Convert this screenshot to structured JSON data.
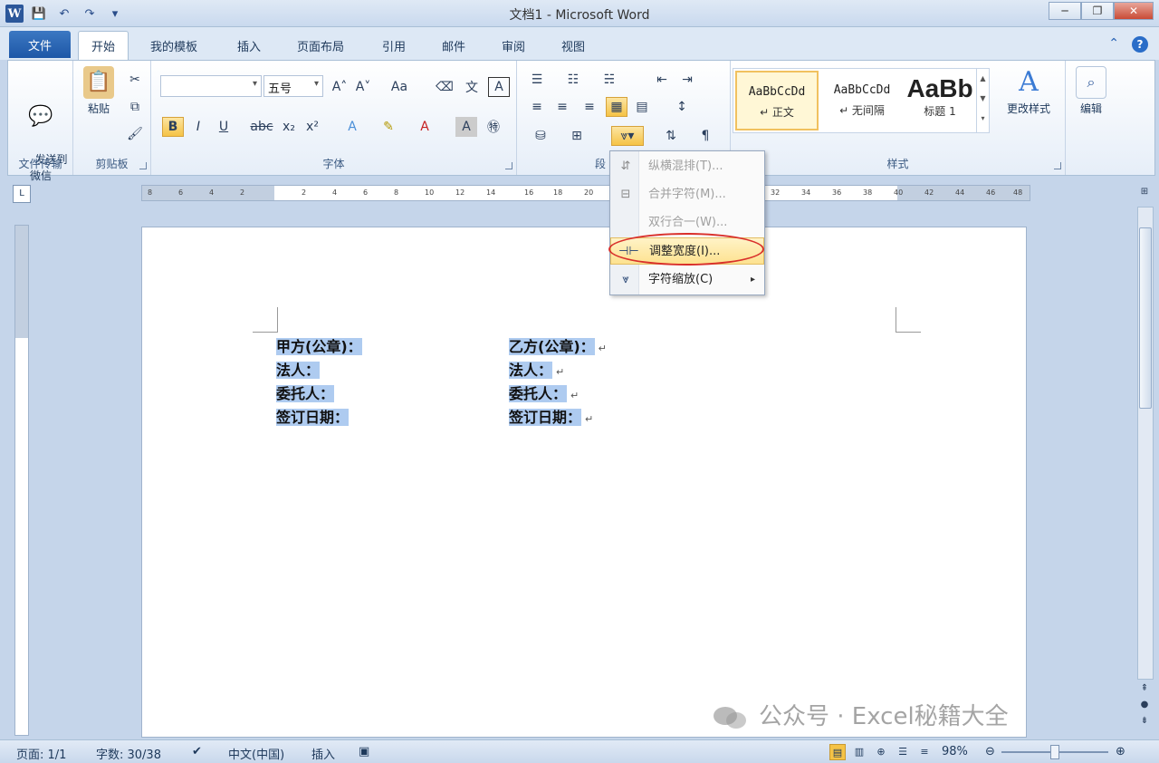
{
  "window": {
    "title": "文档1 - Microsoft Word",
    "app_icon": "W",
    "colors": {
      "accent": "#2b579a",
      "file_tab": "#1d57a7",
      "selection": "#aecbf0",
      "highlight_ring": "#d9302b"
    }
  },
  "quick_access": [
    "save-icon",
    "undo-icon",
    "redo-icon",
    "customize-icon"
  ],
  "tabs": [
    {
      "label": "文件"
    },
    {
      "label": "开始"
    },
    {
      "label": "我的模板"
    },
    {
      "label": "插入"
    },
    {
      "label": "页面布局"
    },
    {
      "label": "引用"
    },
    {
      "label": "邮件"
    },
    {
      "label": "审阅"
    },
    {
      "label": "视图"
    }
  ],
  "ribbon": {
    "groups": {
      "send": {
        "label": "文件传输",
        "button": "发送到\n微信"
      },
      "clipboard": {
        "label": "剪贴板",
        "paste": "粘贴"
      },
      "font": {
        "label": "字体",
        "font_name": "",
        "font_size": "五号"
      },
      "paragraph": {
        "label": "段"
      },
      "styles": {
        "label": "样式",
        "items": [
          {
            "sample": "AaBbCcDd",
            "name": "↵ 正文"
          },
          {
            "sample": "AaBbCcDd",
            "name": "↵ 无间隔"
          },
          {
            "sample": "AaBb",
            "name": "标题 1"
          }
        ],
        "change_styles": "更改样式"
      },
      "editing": {
        "label": "编辑"
      }
    }
  },
  "dropdown_menu": {
    "items": [
      {
        "label": "纵横混排(T)...",
        "enabled": false
      },
      {
        "label": "合并字符(M)...",
        "enabled": false
      },
      {
        "label": "双行合一(W)...",
        "enabled": false
      },
      {
        "label": "调整宽度(I)...",
        "enabled": true,
        "hovered": true
      },
      {
        "label": "字符缩放(C)",
        "enabled": true,
        "submenu": true
      }
    ]
  },
  "ruler": {
    "ticks": [
      "8",
      "6",
      "4",
      "2",
      "",
      "2",
      "4",
      "6",
      "8",
      "10",
      "12",
      "14",
      "16",
      "18",
      "20",
      "",
      "",
      "",
      "",
      "",
      "",
      "32",
      "34",
      "36",
      "38",
      "40",
      "42",
      "44",
      "46",
      "48"
    ]
  },
  "document": {
    "left_column": [
      "甲方(公章)：",
      "法人：",
      "委托人：",
      "签订日期："
    ],
    "right_column": [
      "乙方(公章)：",
      "法人：",
      "委托人：",
      "签订日期："
    ]
  },
  "statusbar": {
    "page": "页面: 1/1",
    "words": "字数: 30/38",
    "language": "中文(中国)",
    "mode": "插入",
    "zoom": "98%"
  },
  "watermark": "公众号 · Excel秘籍大全"
}
